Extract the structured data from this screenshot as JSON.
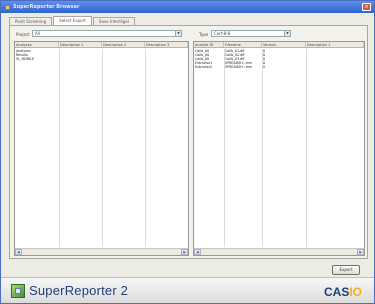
{
  "window": {
    "title": "SuperReporter Browser",
    "close_icon": "close-icon"
  },
  "tabs": [
    {
      "label": "Point Screening"
    },
    {
      "label": "Select Export"
    },
    {
      "label": "Save Interlligel"
    }
  ],
  "left": {
    "label": "Project",
    "select_value": "All",
    "columns": [
      "Analyses",
      "Description 1",
      "Description 2",
      "Description 3"
    ],
    "rows": [
      [
        "Analyses",
        "",
        "",
        ""
      ],
      [
        "Results",
        "",
        "",
        ""
      ],
      [
        "SL_MOBILE",
        "",
        "",
        ""
      ]
    ]
  },
  "right": {
    "label": "Type",
    "select_value": "Cert-8-8",
    "columns": [
      "Analyte ID",
      "Filename",
      "Version",
      "Description 1"
    ],
    "rows": [
      [
        "Calib_00",
        "Calib_01.dff",
        "0",
        ""
      ],
      [
        "Calib_00",
        "Calib_02.dff",
        "0",
        ""
      ],
      [
        "Calib_00",
        "Calib_03.dff",
        "0",
        ""
      ],
      [
        "Extractor1",
        "SPREADSH...mm",
        "0",
        ""
      ],
      [
        "Extractor2",
        "SPREADSH...mm",
        "0",
        ""
      ]
    ]
  },
  "actions": {
    "ok_label": "Export"
  },
  "footer": {
    "product": "SuperReporter 2",
    "brand_main": "CAS",
    "brand_accent": "IO"
  }
}
